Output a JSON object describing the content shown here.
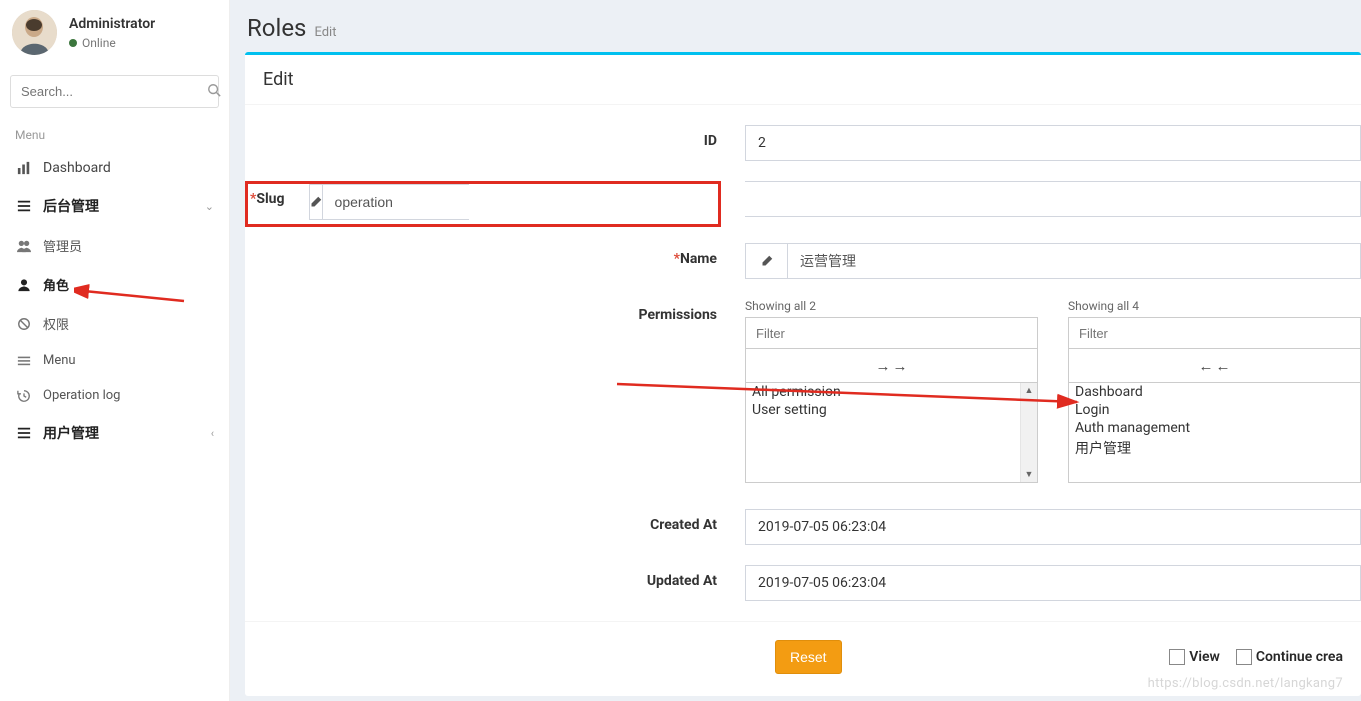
{
  "user": {
    "name": "Administrator",
    "status": "Online"
  },
  "search": {
    "placeholder": "Search..."
  },
  "menu": {
    "header": "Menu",
    "dashboard": "Dashboard",
    "backend": "后台管理",
    "sub": {
      "admins": "管理员",
      "roles": "角色",
      "perms": "权限",
      "menu": "Menu",
      "oplog": "Operation log"
    },
    "usermgmt": "用户管理"
  },
  "page": {
    "title": "Roles",
    "subtitle": "Edit"
  },
  "box": {
    "title": "Edit"
  },
  "form": {
    "labels": {
      "id": "ID",
      "slug": "Slug",
      "name": "Name",
      "permissions": "Permissions",
      "created": "Created At",
      "updated": "Updated At"
    },
    "id": "2",
    "slug": "operation",
    "name": "运营管理",
    "created_at": "2019-07-05 06:23:04",
    "updated_at": "2019-07-05 06:23:04"
  },
  "dual": {
    "left": {
      "showing": "Showing all 2",
      "filter_placeholder": "Filter",
      "items": [
        "All permission",
        "User setting"
      ]
    },
    "right": {
      "showing": "Showing all 4",
      "filter_placeholder": "Filter",
      "items": [
        "Dashboard",
        "Login",
        "Auth management",
        "用户管理"
      ]
    }
  },
  "footer": {
    "reset": "Reset",
    "view": "View",
    "continue": "Continue crea"
  },
  "watermark": "https://blog.csdn.net/langkang7"
}
